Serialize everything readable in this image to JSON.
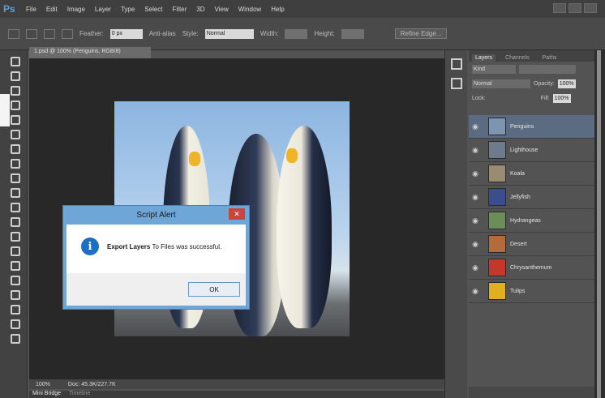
{
  "app": {
    "logo": "Ps"
  },
  "menu": [
    "File",
    "Edit",
    "Image",
    "Layer",
    "Type",
    "Select",
    "Filter",
    "3D",
    "View",
    "Window",
    "Help"
  ],
  "options": {
    "feather_label": "Feather:",
    "feather_value": "0 px",
    "antialias_label": "Anti-alias",
    "style_label": "Style:",
    "style_value": "Normal",
    "width_label": "Width:",
    "height_label": "Height:",
    "refine_label": "Refine Edge..."
  },
  "document": {
    "tab_title": "1.psd @ 100% (Penguins, RGB/8)",
    "zoom": "100%",
    "doc_size": "Doc: 45.3K/227.7K"
  },
  "bottom_tabs": [
    "Mini Bridge",
    "Timeline"
  ],
  "panel": {
    "tabs": [
      "Layers",
      "Channels",
      "Paths"
    ],
    "kind_label": "Kind",
    "blend_mode": "Normal",
    "opacity_label": "Opacity:",
    "opacity_value": "100%",
    "lock_label": "Lock:",
    "fill_label": "Fill:",
    "fill_value": "100%",
    "layers": [
      {
        "name": "Penguins",
        "selected": true,
        "thumb": "#7e94b3"
      },
      {
        "name": "Lighthouse",
        "selected": false,
        "thumb": "#6d7b8c"
      },
      {
        "name": "Koala",
        "selected": false,
        "thumb": "#9a8b73"
      },
      {
        "name": "Jellyfish",
        "selected": false,
        "thumb": "#3a4d8f"
      },
      {
        "name": "Hydrangeas",
        "selected": false,
        "thumb": "#6b8d5a"
      },
      {
        "name": "Desert",
        "selected": false,
        "thumb": "#b56a3a"
      },
      {
        "name": "Chrysanthemum",
        "selected": false,
        "thumb": "#c0392b"
      },
      {
        "name": "Tulips",
        "selected": false,
        "thumb": "#e0b020"
      }
    ]
  },
  "dialog": {
    "title": "Script Alert",
    "close_glyph": "✕",
    "info_glyph": "i",
    "message_bold": "Export Layers",
    "message_rest": " To Files was successful.",
    "ok_label": "OK"
  },
  "colors": {
    "accent": "#1d6fc4",
    "selection": "#5b6b82",
    "dialog_title": "#6ea6d8"
  }
}
